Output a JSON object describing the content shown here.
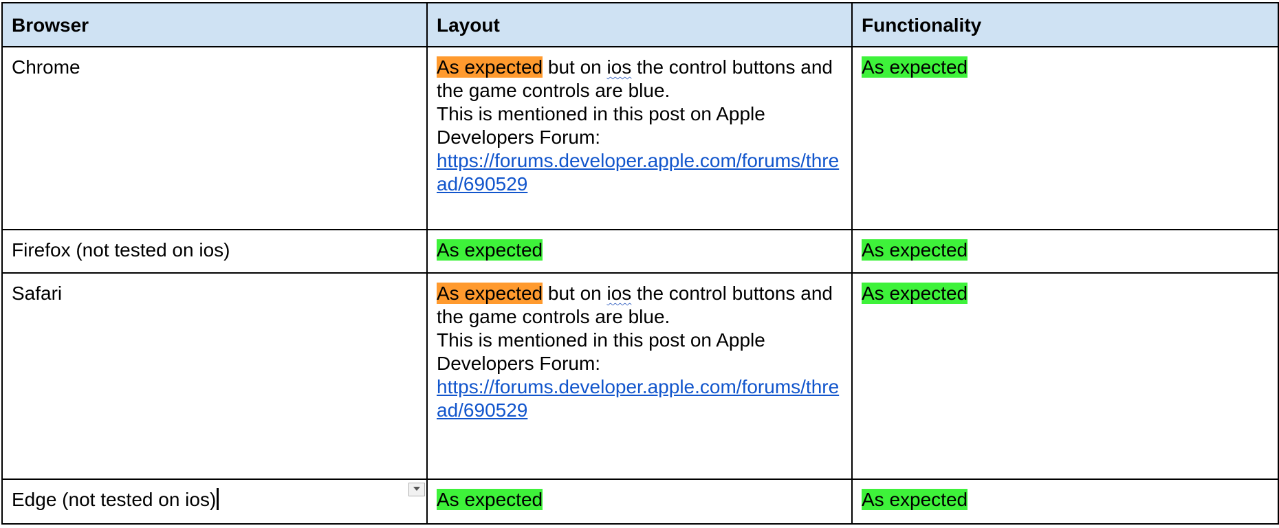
{
  "table": {
    "headers": [
      "Browser",
      "Layout",
      "Functionality"
    ],
    "rows": [
      {
        "browser": "Chrome",
        "layout": {
          "highlight": "As expected",
          "text_a": " but on ",
          "squiggle": "ios",
          "text_b": " the control buttons and the game controls are blue.",
          "line2": "This is mentioned in this post on Apple Developers Forum:",
          "link": "https://forums.developer.apple.com/forums/thread/690529"
        },
        "functionality": "As expected"
      },
      {
        "browser": "Firefox (not tested on ios)",
        "layout": "As expected",
        "functionality": "As expected"
      },
      {
        "browser": "Safari",
        "layout": {
          "highlight": "As expected",
          "text_a": " but on ",
          "squiggle": "ios",
          "text_b": " the control buttons and the game controls are blue.",
          "line2": "This is mentioned in this post on Apple Developers Forum:",
          "link": "https://forums.developer.apple.com/forums/thread/690529"
        },
        "functionality": "As expected"
      },
      {
        "browser": "Edge (not tested on ios)",
        "layout": "As expected",
        "functionality": "As expected"
      }
    ]
  },
  "colors": {
    "header_bg": "#cfe2f3",
    "highlight_orange": "#ff9a2e",
    "highlight_green": "#3ef23a",
    "link": "#1155cc"
  },
  "icons": [
    "dropdown-arrow-icon"
  ]
}
